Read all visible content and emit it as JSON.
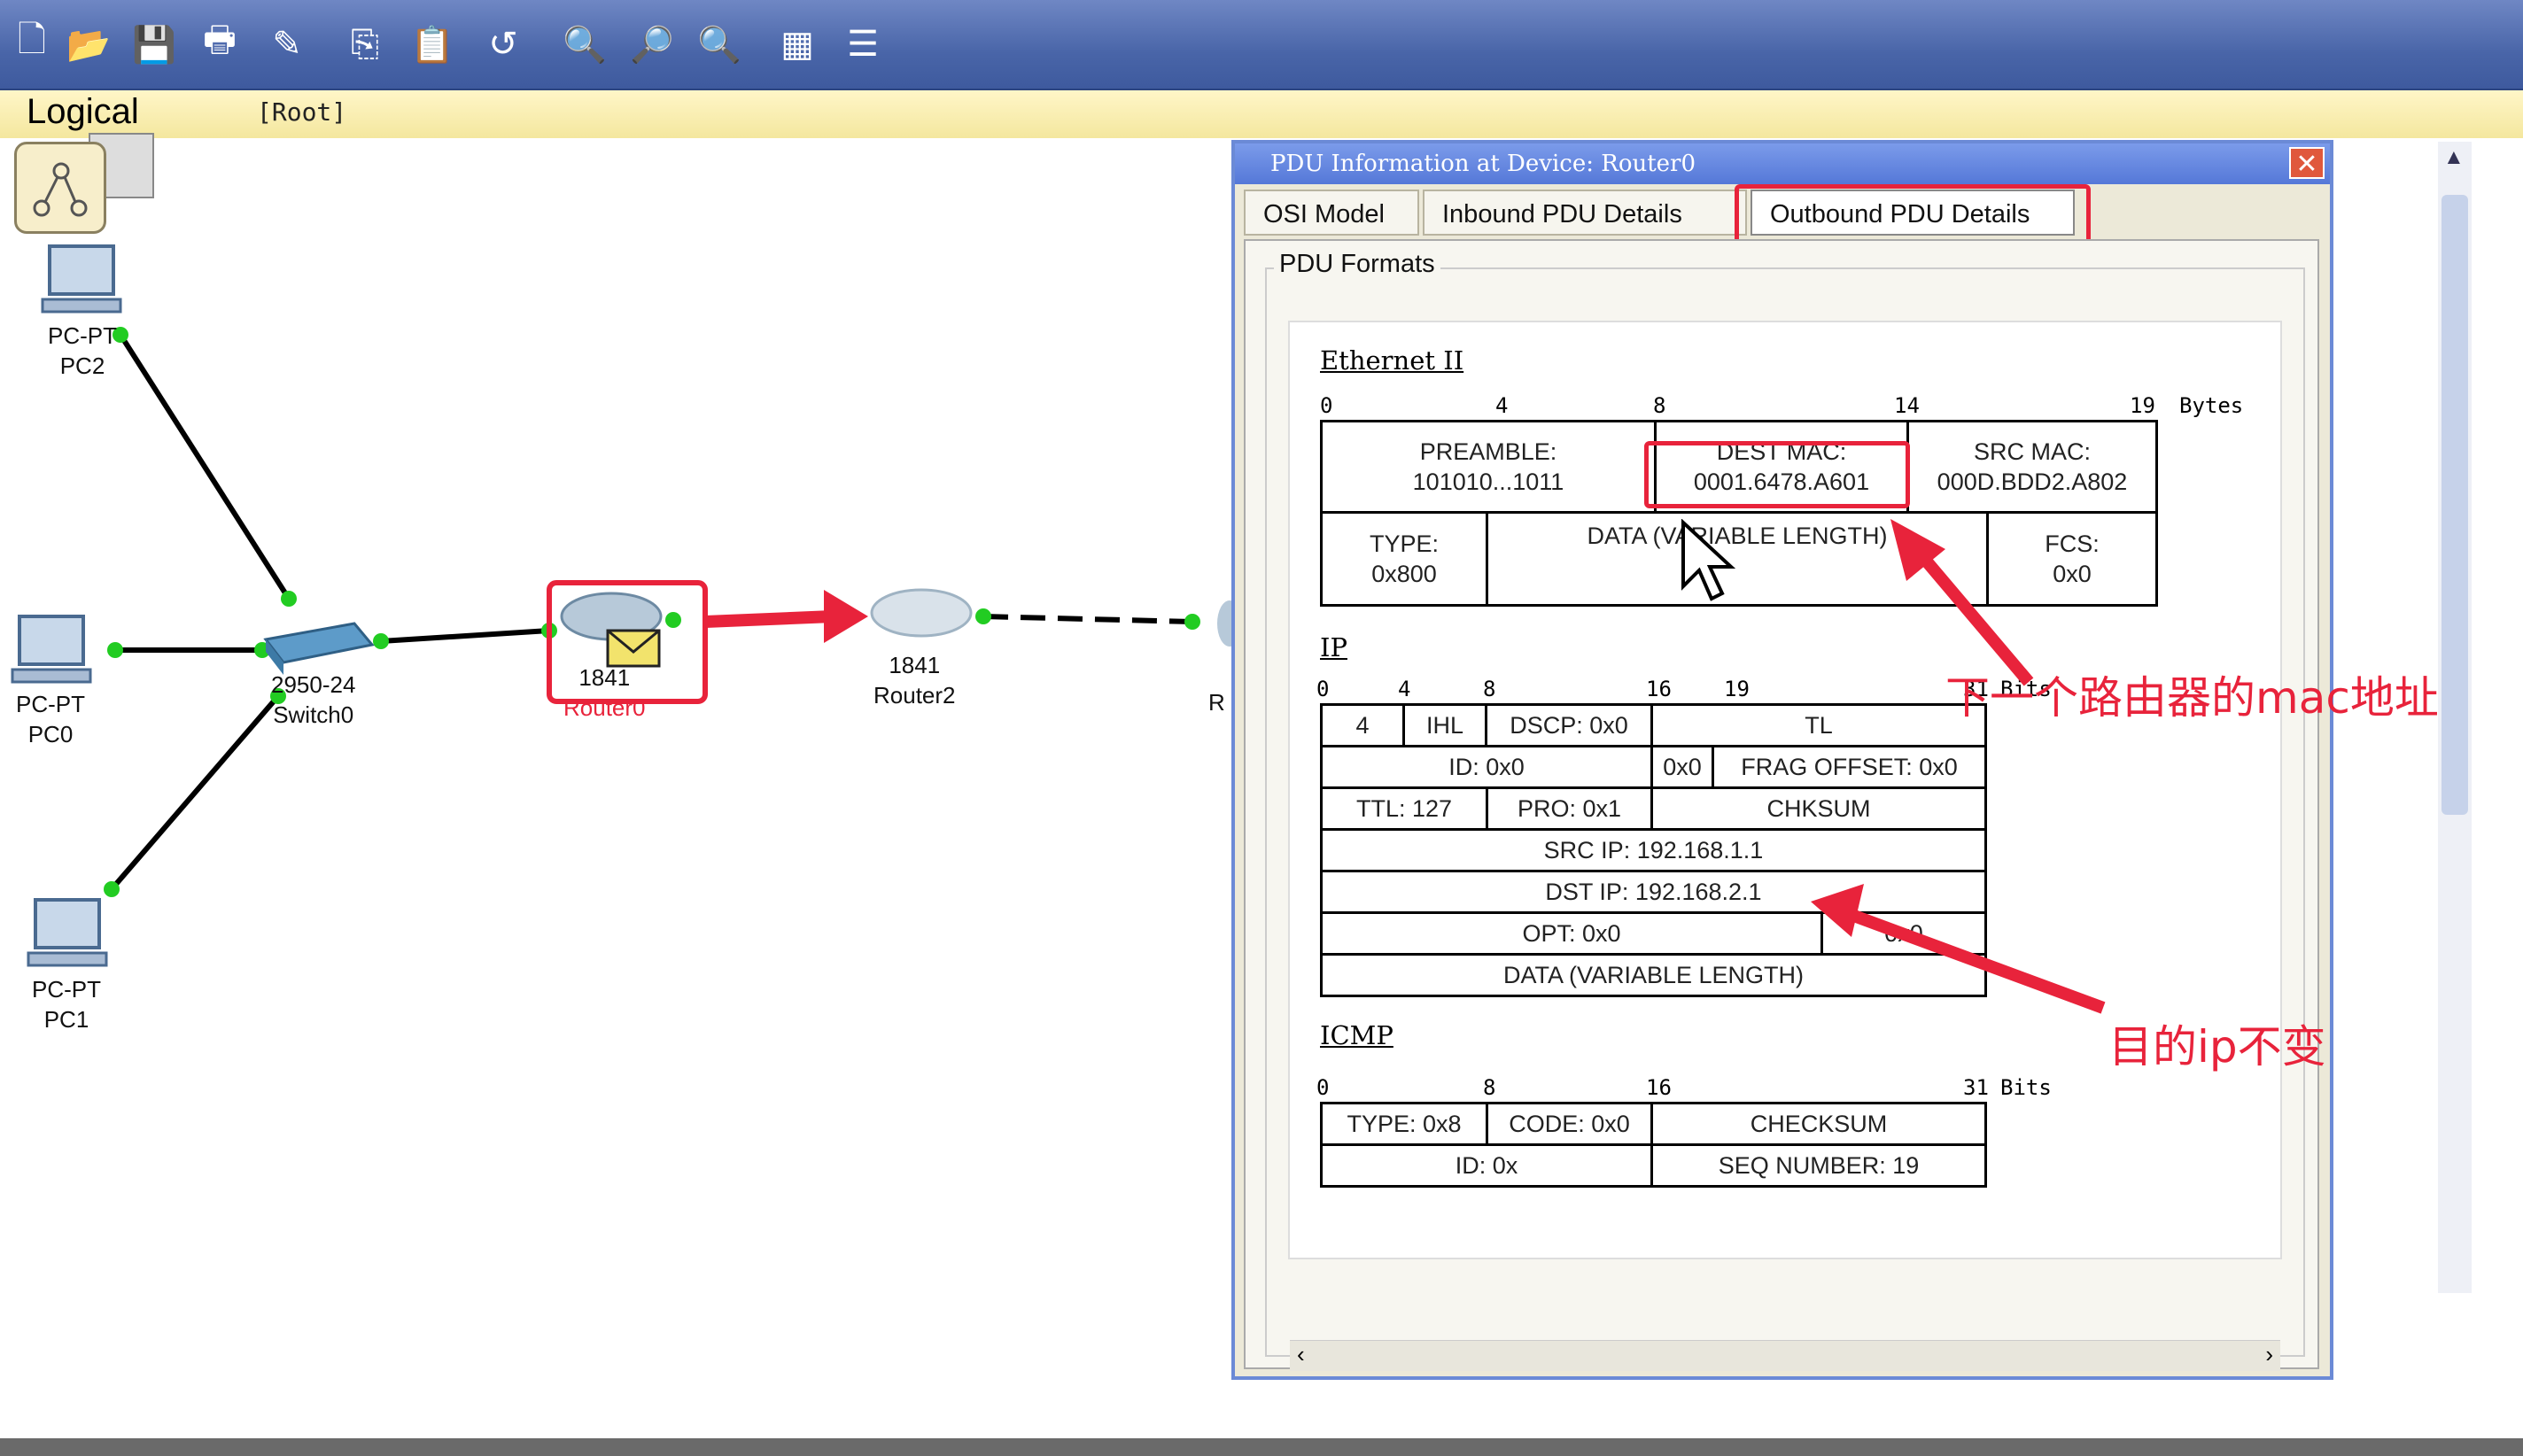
{
  "workspace": {
    "mode_label": "Logical",
    "root_label": "[Root]"
  },
  "toolbar": {
    "icons": [
      "new-icon",
      "open-icon",
      "save-icon",
      "print-icon",
      "edit-icon",
      "copy-icon",
      "paste-icon",
      "undo-icon",
      "zoom-in-icon",
      "zoom-reset-icon",
      "zoom-out-icon",
      "palette-icon",
      "device-icon"
    ]
  },
  "devices": {
    "pc2": {
      "line1": "PC-PT",
      "line2": "PC2"
    },
    "pc0": {
      "line1": "PC-PT",
      "line2": "PC0"
    },
    "pc1": {
      "line1": "PC-PT",
      "line2": "PC1"
    },
    "switch0": {
      "line1": "2950-24",
      "line2": "Switch0"
    },
    "router0": {
      "line1": "1841",
      "line2": "Router0"
    },
    "router2": {
      "line1": "1841",
      "line2": "Router2"
    },
    "router_next": {
      "line1": "R"
    }
  },
  "pdu_window": {
    "title": "PDU Information at Device: Router0",
    "close": "✕",
    "tabs": [
      "OSI Model",
      "Inbound PDU Details",
      "Outbound PDU Details"
    ],
    "group_label": "PDU Formats",
    "ethernet": {
      "title": "Ethernet II",
      "ruler": [
        "0",
        "4",
        "8",
        "14",
        "19",
        "Bytes"
      ],
      "preamble": {
        "label": "PREAMBLE:",
        "value": "101010...1011"
      },
      "dest_mac": {
        "label": "DEST MAC:",
        "value": "0001.6478.A601"
      },
      "src_mac": {
        "label": "SRC MAC:",
        "value": "000D.BDD2.A802"
      },
      "type": {
        "label": "TYPE:",
        "value": "0x800"
      },
      "data": "DATA (VARIABLE LENGTH)",
      "fcs": {
        "label": "FCS:",
        "value": "0x0"
      }
    },
    "ip": {
      "title": "IP",
      "ruler": [
        "0",
        "4",
        "8",
        "16",
        "19",
        "31",
        "Bits"
      ],
      "version": "4",
      "ihl": "IHL",
      "dscp": "DSCP: 0x0",
      "tl": "TL",
      "id": "ID: 0x0",
      "flags": "0x0",
      "frag_offset": "FRAG OFFSET: 0x0",
      "ttl": "TTL: 127",
      "pro": "PRO: 0x1",
      "chksum": "CHKSUM",
      "src_ip": "SRC IP: 192.168.1.1",
      "dst_ip": "DST IP: 192.168.2.1",
      "opt": "OPT: 0x0",
      "opt_right": "0x0",
      "data": "DATA (VARIABLE LENGTH)"
    },
    "icmp": {
      "title": "ICMP",
      "ruler": [
        "0",
        "8",
        "16",
        "31",
        "Bits"
      ],
      "type": "TYPE: 0x8",
      "code": "CODE: 0x0",
      "checksum": "CHECKSUM",
      "id": "ID: 0x",
      "seq": "SEQ NUMBER: 19"
    }
  },
  "annotations": {
    "mac_note": "下一个路由器的mac地址",
    "ip_note": "目的ip不变"
  },
  "colors": {
    "annotation": "#e8233b",
    "link_dot": "#22cc22"
  }
}
